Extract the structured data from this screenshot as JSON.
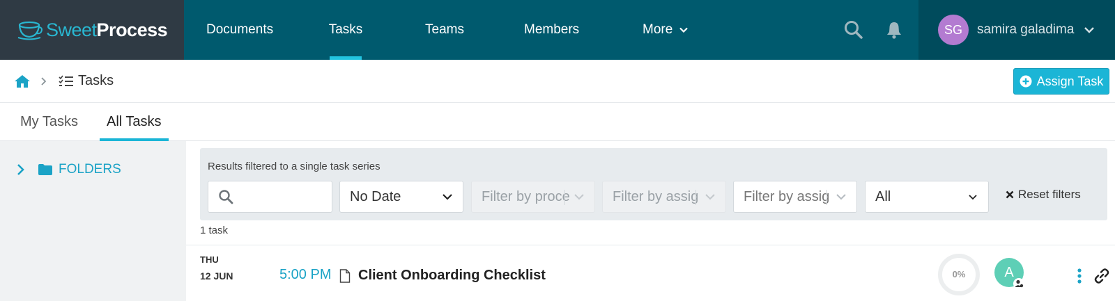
{
  "brand": {
    "name_light": "Sweet",
    "name_bold": "Process"
  },
  "nav": {
    "documents": "Documents",
    "tasks": "Tasks",
    "teams": "Teams",
    "members": "Members",
    "more": "More"
  },
  "user": {
    "initials": "SG",
    "name": "samira galadima"
  },
  "breadcrumb": {
    "current": "Tasks"
  },
  "assign_task_label": "Assign Task",
  "tabs": {
    "my_tasks": "My Tasks",
    "all_tasks": "All Tasks"
  },
  "sidebar": {
    "folders_label": "FOLDERS"
  },
  "filters": {
    "note": "Results filtered to a single task series",
    "search_value": "",
    "date": "No Date",
    "process_placeholder": "Filter by proce",
    "assignee_placeholder_1": "Filter by assig",
    "assignee_placeholder_2": "Filter by assig",
    "status": "All",
    "reset_label": "Reset filters"
  },
  "task_count": "1 task",
  "tasks": [
    {
      "day": "THU",
      "date": "12 JUN",
      "time": "5:00 PM",
      "title": "Client Onboarding Checklist",
      "progress": "0%",
      "progress_fraction": 0,
      "assignee_initial": "A"
    }
  ],
  "colors": {
    "nav_bg": "#005a6e",
    "brand_bg": "#2f3a44",
    "accent": "#1bb5d6",
    "avatar": "#b37bd1",
    "assignee": "#5ecfb6"
  }
}
